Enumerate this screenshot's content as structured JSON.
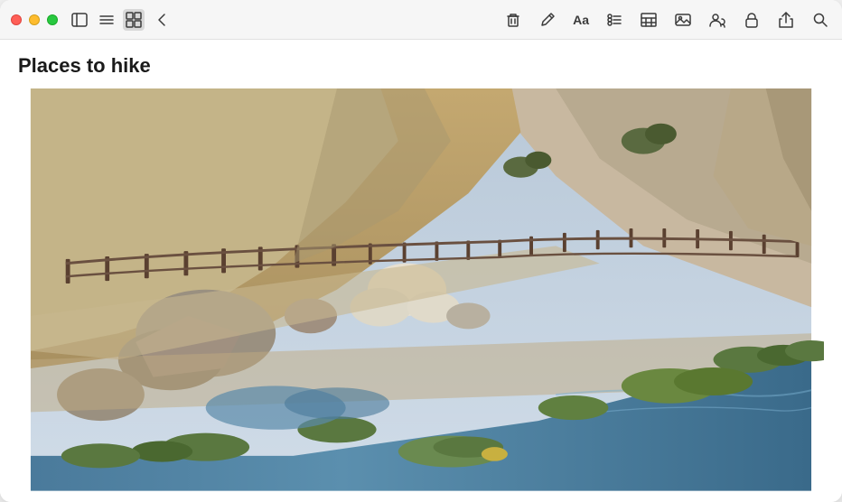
{
  "window": {
    "title": "Places to hike"
  },
  "titlebar": {
    "traffic_lights": {
      "close_label": "Close",
      "minimize_label": "Minimize",
      "maximize_label": "Maximize"
    },
    "toolbar": {
      "sidebar_icon": "sidebar",
      "list_icon": "list",
      "grid_icon": "grid",
      "back_icon": "chevron-left",
      "delete_icon": "trash",
      "compose_icon": "compose",
      "format_icon": "Aa",
      "checklist_icon": "checklist",
      "table_icon": "table",
      "media_icon": "media",
      "collaborate_icon": "collaborate",
      "lock_icon": "lock",
      "share_icon": "share",
      "search_icon": "search"
    }
  },
  "note": {
    "title": "Places to hike",
    "image_alt": "Hiking trail with wooden fence along rocky hillside and river"
  }
}
